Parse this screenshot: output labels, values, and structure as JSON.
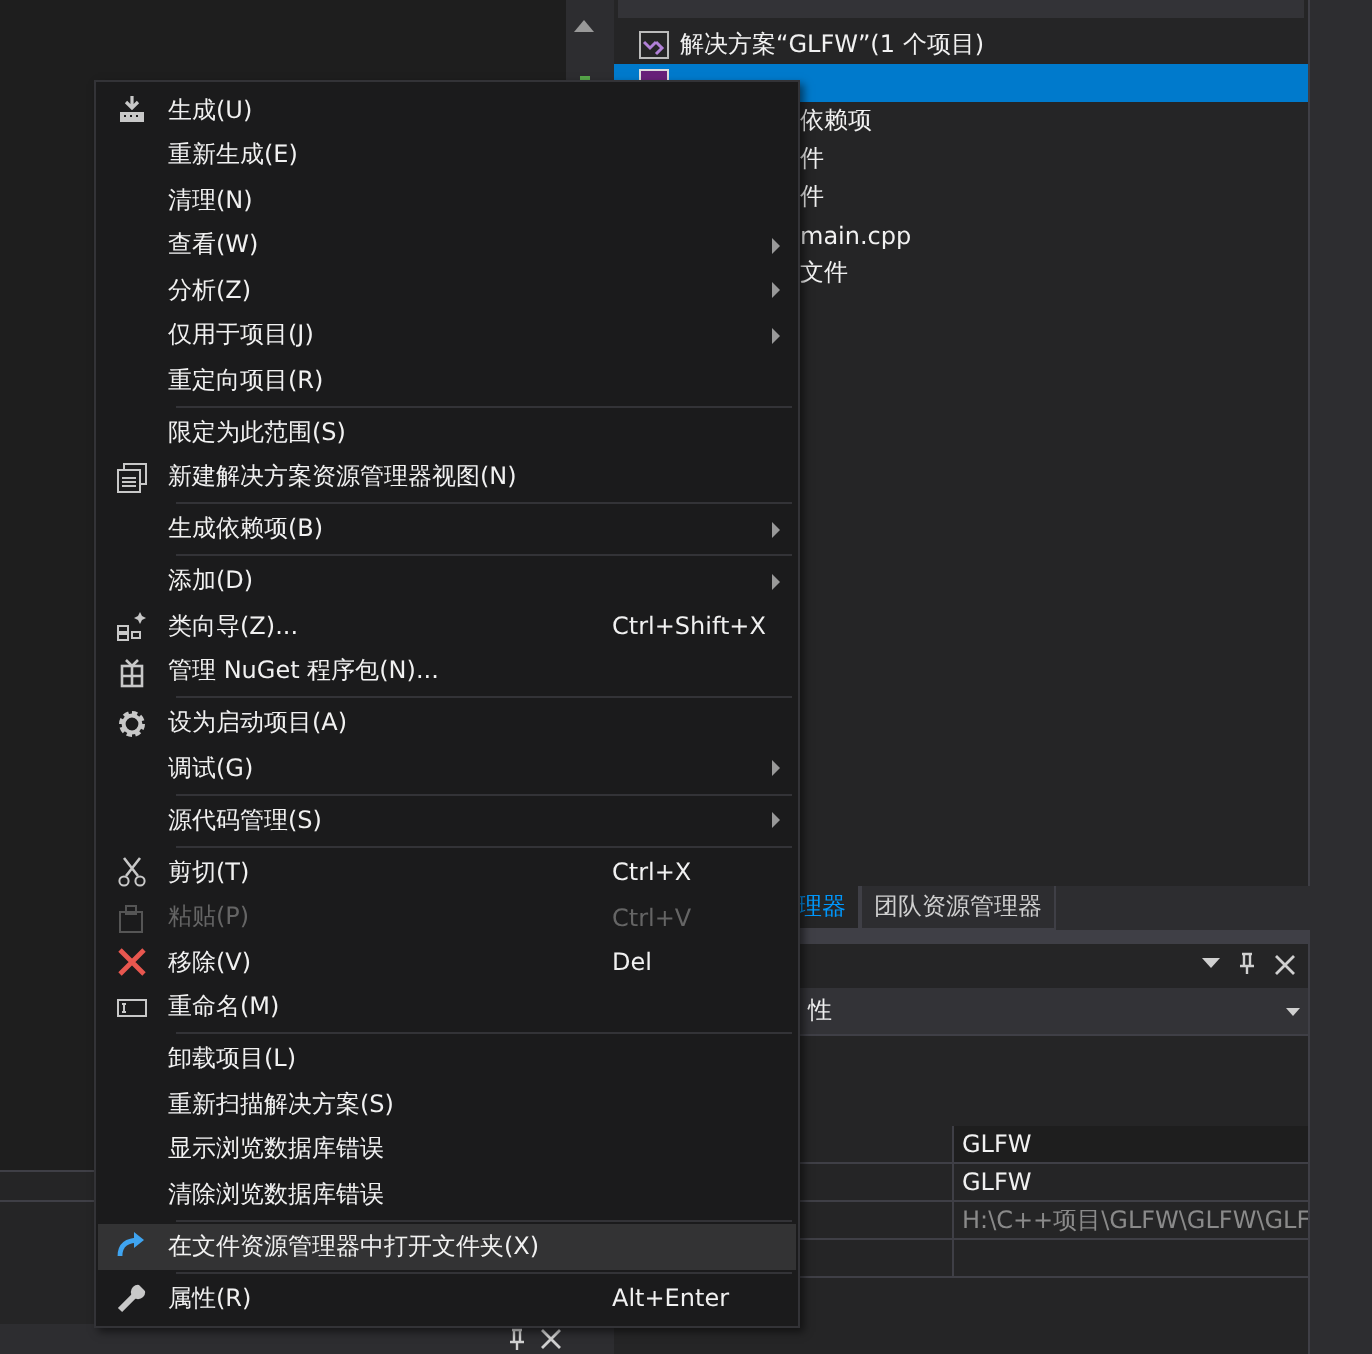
{
  "solution_explorer": {
    "tree": [
      {
        "label": "解决方案“GLFW”(1 个项目)",
        "selected": false,
        "children": [
          {
            "selected": true,
            "children": [
              {
                "label": "依赖项",
                "selected": false
              },
              {
                "label": "件",
                "selected": false
              },
              {
                "label": "件",
                "selected": false,
                "children": [
                  {
                    "label": "main.cpp",
                    "selected": false
                  }
                ]
              },
              {
                "label": "文件",
                "selected": false
              }
            ]
          }
        ]
      }
    ]
  },
  "tabs": [
    {
      "label": "理器",
      "selected": true
    },
    {
      "label": "团队资源管理器",
      "selected": false
    }
  ],
  "properties": {
    "selector": "性",
    "rows": [
      {
        "value": "GLFW",
        "disabled": false
      },
      {
        "value": "GLFW",
        "disabled": false
      },
      {
        "value": "H:\\C++项目\\GLFW\\GLFW\\GLF",
        "disabled": true
      }
    ]
  },
  "context_menu": {
    "items": [
      {
        "kind": "item",
        "label": "生成(U)",
        "submenu": false,
        "disabled": false,
        "selected": false
      },
      {
        "kind": "item",
        "label": "重新生成(E)",
        "submenu": false,
        "disabled": false,
        "selected": false
      },
      {
        "kind": "item",
        "label": "清理(N)",
        "submenu": false,
        "disabled": false,
        "selected": false
      },
      {
        "kind": "item",
        "label": "查看(W)",
        "submenu": true,
        "disabled": false,
        "selected": false
      },
      {
        "kind": "item",
        "label": "分析(Z)",
        "submenu": true,
        "disabled": false,
        "selected": false
      },
      {
        "kind": "item",
        "label": "仅用于项目(J)",
        "submenu": true,
        "disabled": false,
        "selected": false
      },
      {
        "kind": "item",
        "label": "重定向项目(R)",
        "submenu": false,
        "disabled": false,
        "selected": false
      },
      {
        "kind": "separator"
      },
      {
        "kind": "item",
        "label": "限定为此范围(S)",
        "submenu": false,
        "disabled": false,
        "selected": false
      },
      {
        "kind": "item",
        "label": "新建解决方案资源管理器视图(N)",
        "submenu": false,
        "disabled": false,
        "selected": false
      },
      {
        "kind": "separator"
      },
      {
        "kind": "item",
        "label": "生成依赖项(B)",
        "submenu": true,
        "disabled": false,
        "selected": false
      },
      {
        "kind": "separator"
      },
      {
        "kind": "item",
        "label": "添加(D)",
        "submenu": true,
        "disabled": false,
        "selected": false
      },
      {
        "kind": "item",
        "label": "类向导(Z)...",
        "shortcut": "Ctrl+Shift+X",
        "submenu": false,
        "disabled": false,
        "selected": false
      },
      {
        "kind": "item",
        "label": "管理 NuGet 程序包(N)...",
        "submenu": false,
        "disabled": false,
        "selected": false
      },
      {
        "kind": "separator"
      },
      {
        "kind": "item",
        "label": "设为启动项目(A)",
        "submenu": false,
        "disabled": false,
        "selected": false
      },
      {
        "kind": "item",
        "label": "调试(G)",
        "submenu": true,
        "disabled": false,
        "selected": false
      },
      {
        "kind": "separator"
      },
      {
        "kind": "item",
        "label": "源代码管理(S)",
        "submenu": true,
        "disabled": false,
        "selected": false
      },
      {
        "kind": "separator"
      },
      {
        "kind": "item",
        "label": "剪切(T)",
        "shortcut": "Ctrl+X",
        "submenu": false,
        "disabled": false,
        "selected": false
      },
      {
        "kind": "item",
        "label": "粘贴(P)",
        "shortcut": "Ctrl+V",
        "submenu": false,
        "disabled": true,
        "selected": false
      },
      {
        "kind": "item",
        "label": "移除(V)",
        "shortcut": "Del",
        "submenu": false,
        "disabled": false,
        "selected": false
      },
      {
        "kind": "item",
        "label": "重命名(M)",
        "submenu": false,
        "disabled": false,
        "selected": false
      },
      {
        "kind": "separator"
      },
      {
        "kind": "item",
        "label": "卸载项目(L)",
        "submenu": false,
        "disabled": false,
        "selected": false
      },
      {
        "kind": "item",
        "label": "重新扫描解决方案(S)",
        "submenu": false,
        "disabled": false,
        "selected": false
      },
      {
        "kind": "item",
        "label": "显示浏览数据库错误",
        "submenu": false,
        "disabled": false,
        "selected": false
      },
      {
        "kind": "item",
        "label": "清除浏览数据库错误",
        "submenu": false,
        "disabled": false,
        "selected": false
      },
      {
        "kind": "separator"
      },
      {
        "kind": "item",
        "label": "在文件资源管理器中打开文件夹(X)",
        "submenu": false,
        "disabled": false,
        "selected": true
      },
      {
        "kind": "separator"
      },
      {
        "kind": "item",
        "label": "属性(R)",
        "shortcut": "Alt+Enter",
        "submenu": false,
        "disabled": false,
        "selected": false
      }
    ]
  }
}
